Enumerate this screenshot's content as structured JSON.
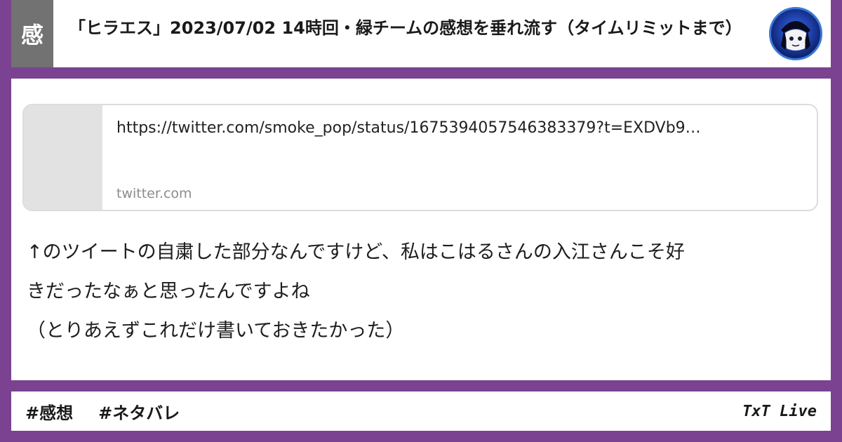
{
  "header": {
    "category": "感",
    "title": "「ヒラエス」2023/07/02 14時回・緑チームの感想を垂れ流す（タイムリミットまで）"
  },
  "link_card": {
    "url": "https://twitter.com/smoke_pop/status/1675394057546383379?t=EXDVb9…",
    "domain": "twitter.com"
  },
  "body": {
    "line1": "↑のツイートの自粛した部分なんですけど、私はこはるさんの入江さんこそ好",
    "line2": "きだったなぁと思ったんですよね",
    "line3": "（とりあえずこれだけ書いておきたかった）"
  },
  "footer": {
    "tags": [
      "#感想",
      "#ネタバレ"
    ],
    "brand": "TxT Live"
  },
  "colors": {
    "frame": "#7a4291",
    "badge": "#727272",
    "avatar_bg": "#1d3fa8"
  }
}
